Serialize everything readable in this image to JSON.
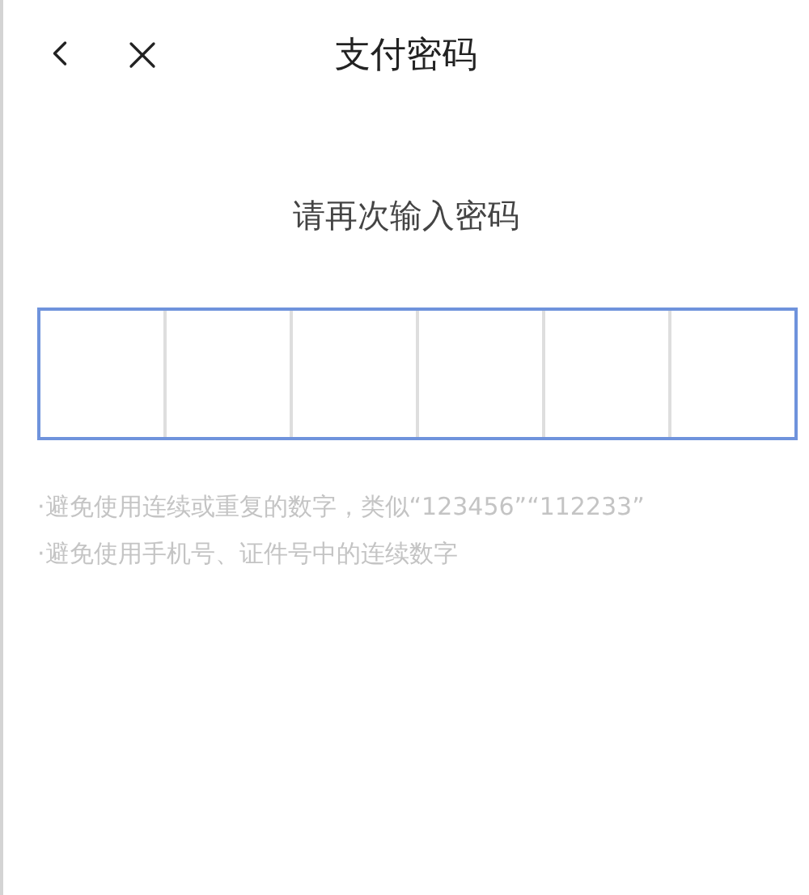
{
  "header": {
    "title": "支付密码"
  },
  "prompt": "请再次输入密码",
  "pin_box": {
    "focused": true
  },
  "hints": [
    "·避免使用连续或重复的数字，类似“123456”“112233”",
    "·避免使用手机号、证件号中的连续数字"
  ]
}
